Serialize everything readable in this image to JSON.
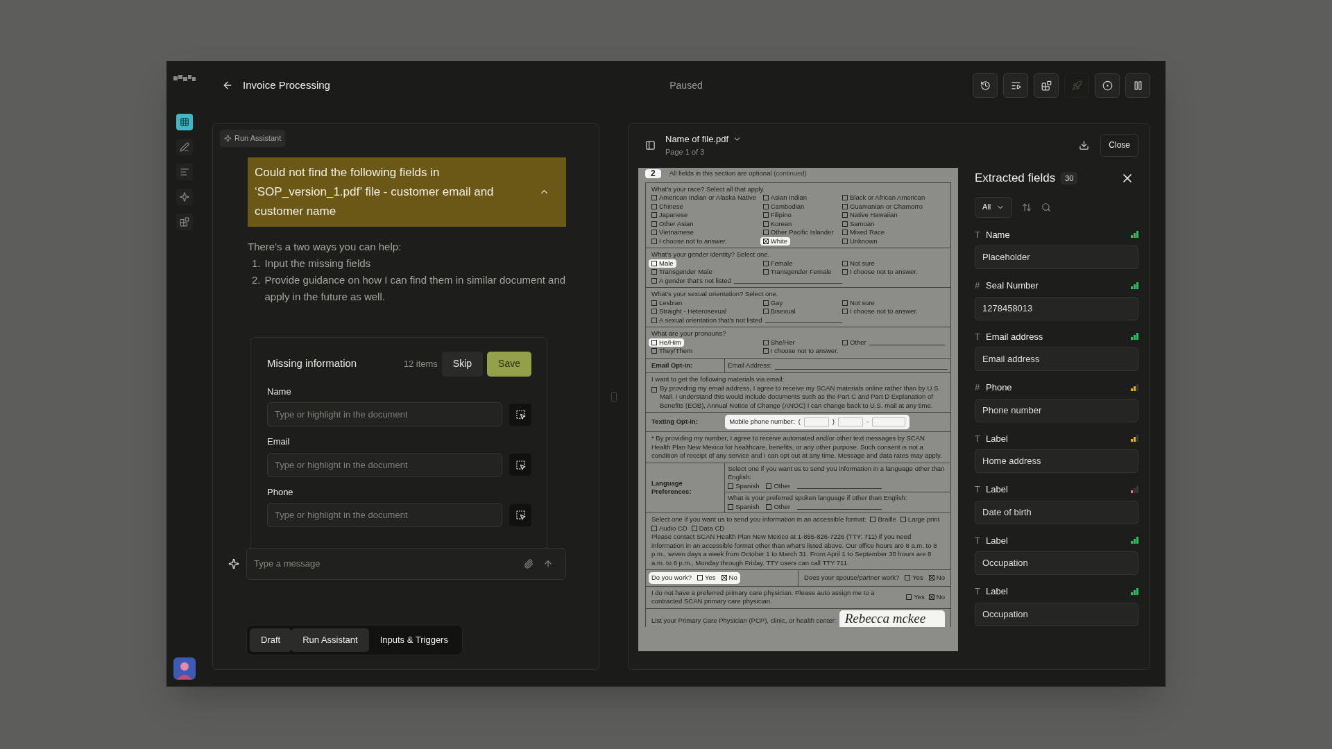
{
  "app": {
    "title": "Invoice Processing",
    "status": "Paused"
  },
  "rail": [
    {
      "kind": "grid",
      "selected": true
    },
    {
      "kind": "pen",
      "selected": false
    },
    {
      "kind": "lines",
      "selected": false
    },
    {
      "kind": "sparkle",
      "selected": false
    },
    {
      "kind": "blocks",
      "selected": false
    }
  ],
  "toolbar": [
    {
      "kind": "history",
      "disabled": false
    },
    {
      "kind": "queue",
      "disabled": false
    },
    {
      "kind": "blocks",
      "disabled": false
    },
    {
      "kind": "rocket",
      "disabled": true
    },
    {
      "kind": "target",
      "disabled": false
    },
    {
      "kind": "pause",
      "disabled": false
    }
  ],
  "assistant": {
    "chip": "Run Assistant",
    "alert": {
      "text": "Could not find the following fields in ‘SOP_version_1.pdf’ file - customer email and customer name",
      "expanded": true
    },
    "intro": "There's a two ways you can help:",
    "steps": [
      {
        "number": "1.",
        "text": "Input the missing fields"
      },
      {
        "number": "2.",
        "text": "Provide guidance on how I can find them in similar document and apply in the future as well."
      }
    ],
    "missing": {
      "title": "Missing information",
      "count": "12 items",
      "skip": "Skip",
      "save": "Save",
      "fields": [
        {
          "label": "Name",
          "placeholder": "Type or highlight in the document"
        },
        {
          "label": "Email",
          "placeholder": "Type or highlight in the document"
        },
        {
          "label": "Phone",
          "placeholder": "Type or highlight in the document"
        }
      ]
    },
    "composer": {
      "placeholder": "Type a message"
    },
    "modes": [
      {
        "label": "Draft",
        "selected": true
      },
      {
        "label": "Run Assistant",
        "selected": true
      },
      {
        "label": "Inputs & Triggers",
        "selected": false
      }
    ]
  },
  "viewer": {
    "file": "Name of file.pdf",
    "page": "Page 1 of 3",
    "close": "Close",
    "document": {
      "badge": "2",
      "heading": "All fields in this section are optional",
      "heading_note": "(continued)",
      "sections": [
        {
          "kind": "choices",
          "question": "What's your race? Select all that apply.",
          "rows": [
            {
              "fill_in": false,
              "options": [
                {
                  "label": "American Indian or Alaska Native",
                  "checked": false,
                  "highlighted": false
                },
                {
                  "label": "Asian Indian",
                  "checked": false,
                  "highlighted": false
                },
                {
                  "label": "Black or African American",
                  "checked": false,
                  "highlighted": false
                }
              ]
            },
            {
              "fill_in": false,
              "options": [
                {
                  "label": "Chinese",
                  "checked": false,
                  "highlighted": false
                },
                {
                  "label": "Cambodian",
                  "checked": false,
                  "highlighted": false
                },
                {
                  "label": "Guamanian or Chamorro",
                  "checked": false,
                  "highlighted": false
                }
              ]
            },
            {
              "fill_in": false,
              "options": [
                {
                  "label": "Japanese",
                  "checked": false,
                  "highlighted": false
                },
                {
                  "label": "Filipino",
                  "checked": false,
                  "highlighted": false
                },
                {
                  "label": "Native Hawaiian",
                  "checked": false,
                  "highlighted": false
                }
              ]
            },
            {
              "fill_in": false,
              "options": [
                {
                  "label": "Other Asian",
                  "checked": false,
                  "highlighted": false
                },
                {
                  "label": "Korean",
                  "checked": false,
                  "highlighted": false
                },
                {
                  "label": "Samoan",
                  "checked": false,
                  "highlighted": false
                }
              ]
            },
            {
              "fill_in": false,
              "options": [
                {
                  "label": "Vietnamese",
                  "checked": false,
                  "highlighted": false
                },
                {
                  "label": "Other Pacific Islander",
                  "checked": false,
                  "highlighted": false
                },
                {
                  "label": "Mixed Race",
                  "checked": false,
                  "highlighted": false
                }
              ]
            },
            {
              "fill_in": false,
              "options": [
                {
                  "label": "I choose not to answer.",
                  "checked": false,
                  "highlighted": false
                },
                {
                  "label": "White",
                  "checked": true,
                  "highlighted": true
                },
                {
                  "label": "Unknown",
                  "checked": false,
                  "highlighted": false
                }
              ]
            }
          ]
        },
        {
          "kind": "choices",
          "question": "What's your gender identity? Select one.",
          "rows": [
            {
              "fill_in": false,
              "options": [
                {
                  "label": "Male",
                  "checked": false,
                  "highlighted": true
                },
                {
                  "label": "Female",
                  "checked": false,
                  "highlighted": false
                },
                {
                  "label": "Not sure",
                  "checked": false,
                  "highlighted": false
                }
              ]
            },
            {
              "fill_in": false,
              "options": [
                {
                  "label": "Transgender Male",
                  "checked": false,
                  "highlighted": false
                },
                {
                  "label": "Transgender Female",
                  "checked": false,
                  "highlighted": false
                },
                {
                  "label": "I choose not to answer.",
                  "checked": false,
                  "highlighted": false
                }
              ]
            },
            {
              "fill_in": true,
              "options": [
                {
                  "label": "A gender that's not listed",
                  "checked": false,
                  "highlighted": false
                }
              ]
            }
          ]
        },
        {
          "kind": "choices",
          "question": "What's your sexual orientation? Select one.",
          "rows": [
            {
              "fill_in": false,
              "options": [
                {
                  "label": "Lesbian",
                  "checked": false,
                  "highlighted": false
                },
                {
                  "label": "Gay",
                  "checked": false,
                  "highlighted": false
                },
                {
                  "label": "Not sure",
                  "checked": false,
                  "highlighted": false
                }
              ]
            },
            {
              "fill_in": false,
              "options": [
                {
                  "label": "Straight - Heterosexual",
                  "checked": false,
                  "highlighted": false
                },
                {
                  "label": "Bisexual",
                  "checked": false,
                  "highlighted": false
                },
                {
                  "label": "I choose not to answer.",
                  "checked": false,
                  "highlighted": false
                }
              ]
            },
            {
              "fill_in": true,
              "options": [
                {
                  "label": "A sexual orientation that's not listed",
                  "checked": false,
                  "highlighted": false
                }
              ]
            }
          ]
        },
        {
          "kind": "choices",
          "question": "What are your pronouns?",
          "rows": [
            {
              "fill_in": true,
              "options": [
                {
                  "label": "He/Him",
                  "checked": false,
                  "highlighted": true
                },
                {
                  "label": "She/Her",
                  "checked": false,
                  "highlighted": false
                },
                {
                  "label": "Other",
                  "checked": false,
                  "highlighted": false
                }
              ]
            },
            {
              "fill_in": false,
              "options": [
                {
                  "label": "They/Them",
                  "checked": false,
                  "highlighted": false
                },
                {
                  "label": "I choose not to answer.",
                  "checked": false,
                  "highlighted": false
                }
              ]
            }
          ]
        },
        {
          "kind": "labeled_line",
          "label": "Email Opt-in:",
          "field_label": "Email Address:"
        },
        {
          "kind": "consent",
          "intro": "I want to get the following materials via email:",
          "text": "By providing my email address, I agree to receive my SCAN materials online rather than by U.S. Mail. I understand this would include documents such as the Part C and Part D Explanation of Benefits (EOB), Annual Notice of Change (ANOC) I can change back to U.S. mail at any time.",
          "checked": false
        },
        {
          "kind": "phone",
          "label": "Texting Opt-in:",
          "field_label": "Mobile phone number:",
          "parts": [
            "(",
            ")",
            "-"
          ],
          "highlighted": true
        },
        {
          "kind": "note",
          "text": "* By providing my number, I agree to receive automated and/or other text messages by SCAN Health Plan New Mexico for healthcare, benefits, or any other purpose. Such consent is not a condition of receipt of any service and I can opt out at any time. Message and data rates may apply."
        },
        {
          "kind": "language",
          "label": "Language Preferences:",
          "questions": [
            {
              "text": "Select one if you want us to send you information in a language other than English:",
              "options": [
                {
                  "label": "Spanish",
                  "checked": false,
                  "highlighted": false
                },
                {
                  "label": "Other",
                  "checked": false,
                  "highlighted": false
                }
              ]
            },
            {
              "text": "What is your preferred spoken language if other than English:",
              "options": [
                {
                  "label": "Spanish",
                  "checked": false,
                  "highlighted": false
                },
                {
                  "label": "Other",
                  "checked": false,
                  "highlighted": false
                }
              ]
            }
          ]
        },
        {
          "kind": "formats",
          "text": "Select one if you want us to send you information in an accessible format:",
          "options": [
            {
              "label": "Braille",
              "checked": false,
              "highlighted": false
            },
            {
              "label": "Large print",
              "checked": false,
              "highlighted": false
            },
            {
              "label": "Audio CD",
              "checked": false,
              "highlighted": false
            },
            {
              "label": "Data CD",
              "checked": false,
              "highlighted": false
            }
          ],
          "note": "Please contact SCAN Health Plan New Mexico at 1-855-826-7226 (TTY: 711) if you need information in an accessible format other than what's listed above. Our office hours are 8 a.m. to 8 p.m., seven days a week from October 1 to March 31. From April 1 to September 30 hours are 8 a.m. to 8 p.m., Monday through Friday. TTY users can call TTY 711."
        },
        {
          "kind": "work",
          "parts": [
            {
              "question": "Do you work?",
              "highlighted": true,
              "options": [
                {
                  "label": "Yes",
                  "checked": false,
                  "highlighted": false
                },
                {
                  "label": "No",
                  "checked": true,
                  "highlighted": false
                }
              ]
            },
            {
              "question": "Does your spouse/partner work?",
              "highlighted": false,
              "options": [
                {
                  "label": "Yes",
                  "checked": false,
                  "highlighted": false
                },
                {
                  "label": "No",
                  "checked": true,
                  "highlighted": false
                }
              ]
            }
          ]
        },
        {
          "kind": "yesno",
          "text": "I do not have a preferred primary care physician. Please auto assign me to a contracted SCAN primary care physician.",
          "options": [
            {
              "label": "Yes",
              "checked": false,
              "highlighted": false
            },
            {
              "label": "No",
              "checked": true,
              "highlighted": false
            }
          ]
        },
        {
          "kind": "handwritten",
          "label": "List your Primary Care Physician (PCP), clinic, or health center:",
          "handwriting": "Rebecca mckee",
          "highlighted": true
        }
      ]
    }
  },
  "extracted": {
    "title": "Extracted fields",
    "count": "30",
    "filter": "All",
    "fields": [
      {
        "icon": "T",
        "label": "Name",
        "value": "Placeholder",
        "color": "#22c55e"
      },
      {
        "icon": "#",
        "label": "Seal Number",
        "value": "1278458013",
        "color": "#22c55e"
      },
      {
        "icon": "T",
        "label": "Email address",
        "value": "Email address",
        "color": "#22c55e"
      },
      {
        "icon": "#",
        "label": "Phone",
        "value": "Phone number",
        "color": "#eab308"
      },
      {
        "icon": "T",
        "label": "Label",
        "value": "Home address",
        "color": "#eab308"
      },
      {
        "icon": "T",
        "label": "Label",
        "value": "Date of birth",
        "color": "#f87171"
      },
      {
        "icon": "T",
        "label": "Label",
        "value": "Occupation",
        "color": "#22c55e"
      },
      {
        "icon": "T",
        "label": "Label",
        "value": "Occupation",
        "color": "#22c55e"
      }
    ]
  }
}
